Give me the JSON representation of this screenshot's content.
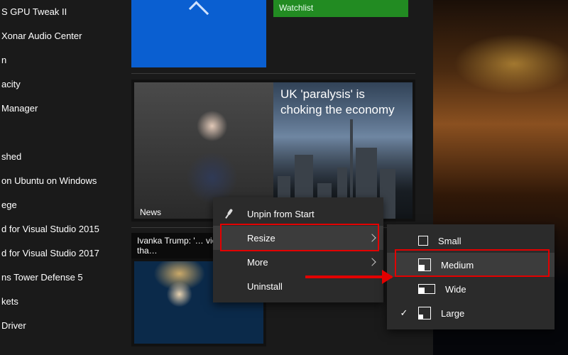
{
  "applist": {
    "items": [
      {
        "label": "S GPU Tweak II"
      },
      {
        "label": "Xonar Audio Center"
      },
      {
        "label": "n"
      },
      {
        "label": "acity"
      },
      {
        "label": "Manager"
      },
      {
        "label": ""
      },
      {
        "label": "shed"
      },
      {
        "label": "on Ubuntu on Windows"
      },
      {
        "label": "ege"
      },
      {
        "label": "d for Visual Studio 2015"
      },
      {
        "label": "d for Visual Studio 2017"
      },
      {
        "label": "ns Tower Defense 5"
      },
      {
        "label": "kets"
      },
      {
        "label": "Driver"
      }
    ]
  },
  "tiles": {
    "watchlist_label": "Watchlist",
    "news_headline": "UK 'paralysis' is choking the economy",
    "news_label": "News",
    "trump_caption": "Ivanka Trump: '… viciousness tha…"
  },
  "context_menu": {
    "unpin": "Unpin from Start",
    "resize": "Resize",
    "more": "More",
    "uninstall": "Uninstall"
  },
  "resize_submenu": {
    "small": "Small",
    "medium": "Medium",
    "wide": "Wide",
    "large": "Large",
    "selected": "large"
  }
}
